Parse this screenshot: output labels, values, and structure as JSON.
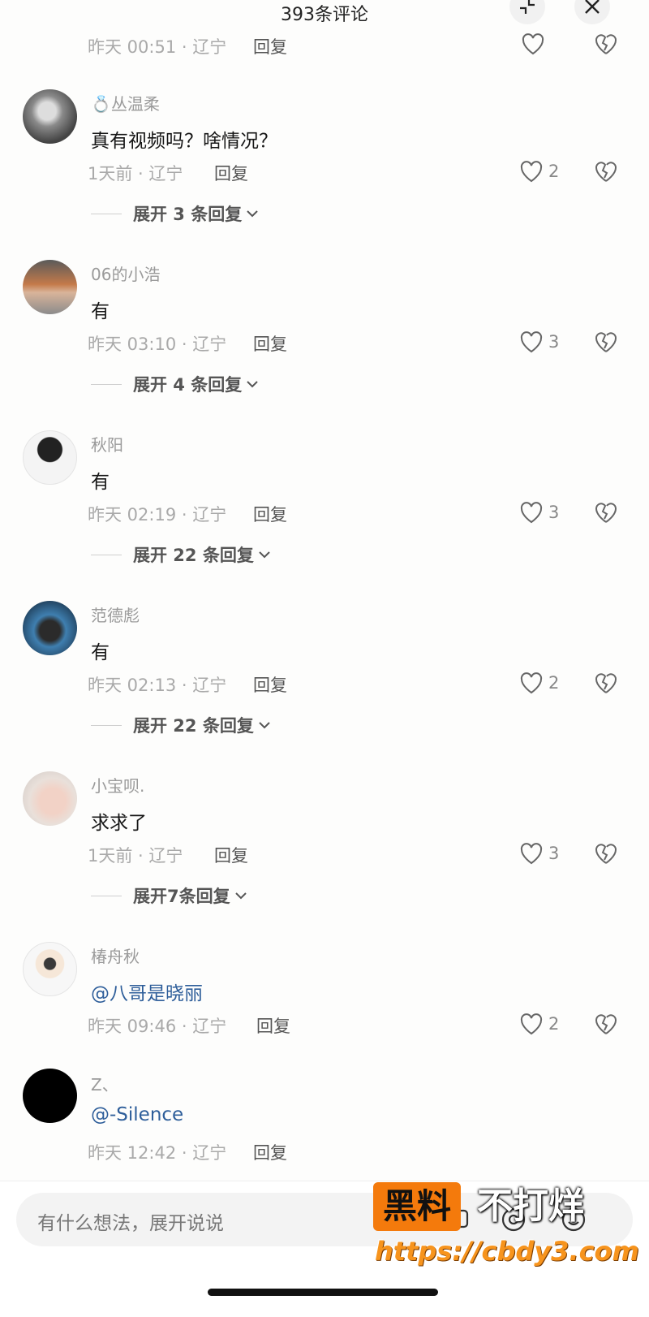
{
  "header": {
    "title": "393条评论"
  },
  "top_partial": {
    "meta": "昨天 00:51 · 辽宁",
    "reply": "回复"
  },
  "comments": [
    {
      "name": "💍丛温柔",
      "text": "真有视频吗？啥情况？",
      "meta": "1天前 · 辽宁",
      "reply": "回复",
      "likes": "2",
      "expand": "展开 3 条回复"
    },
    {
      "name": "06的小浩",
      "text": "有",
      "meta": "昨天 03:10 · 辽宁",
      "reply": "回复",
      "likes": "3",
      "expand": "展开 4 条回复"
    },
    {
      "name": "秋阳",
      "text": "有",
      "meta": "昨天 02:19 · 辽宁",
      "reply": "回复",
      "likes": "3",
      "expand": "展开 22 条回复"
    },
    {
      "name": "范德彪",
      "text": "有",
      "meta": "昨天 02:13 · 辽宁",
      "reply": "回复",
      "likes": "2",
      "expand": "展开 22 条回复"
    },
    {
      "name": "小宝呗.",
      "text": "求求了",
      "meta": "1天前 · 辽宁",
      "reply": "回复",
      "likes": "3",
      "expand": "展开7条回复"
    },
    {
      "name": "椿舟秋",
      "text": "@八哥是晓丽",
      "meta": "昨天 09:46 · 辽宁",
      "reply": "回复",
      "likes": "2"
    },
    {
      "name": "Z、",
      "text": "@-Silence",
      "meta": "昨天 12:42 · 辽宁",
      "reply": "回复"
    }
  ],
  "input": {
    "placeholder": "有什么想法，展开说说"
  },
  "watermark": {
    "box": "黑料",
    "rest": "不打烊",
    "url": "https://cbdy3.com"
  },
  "colors": {
    "mention": "#2e5e9a",
    "watermark_orange": "#f47a0c"
  }
}
